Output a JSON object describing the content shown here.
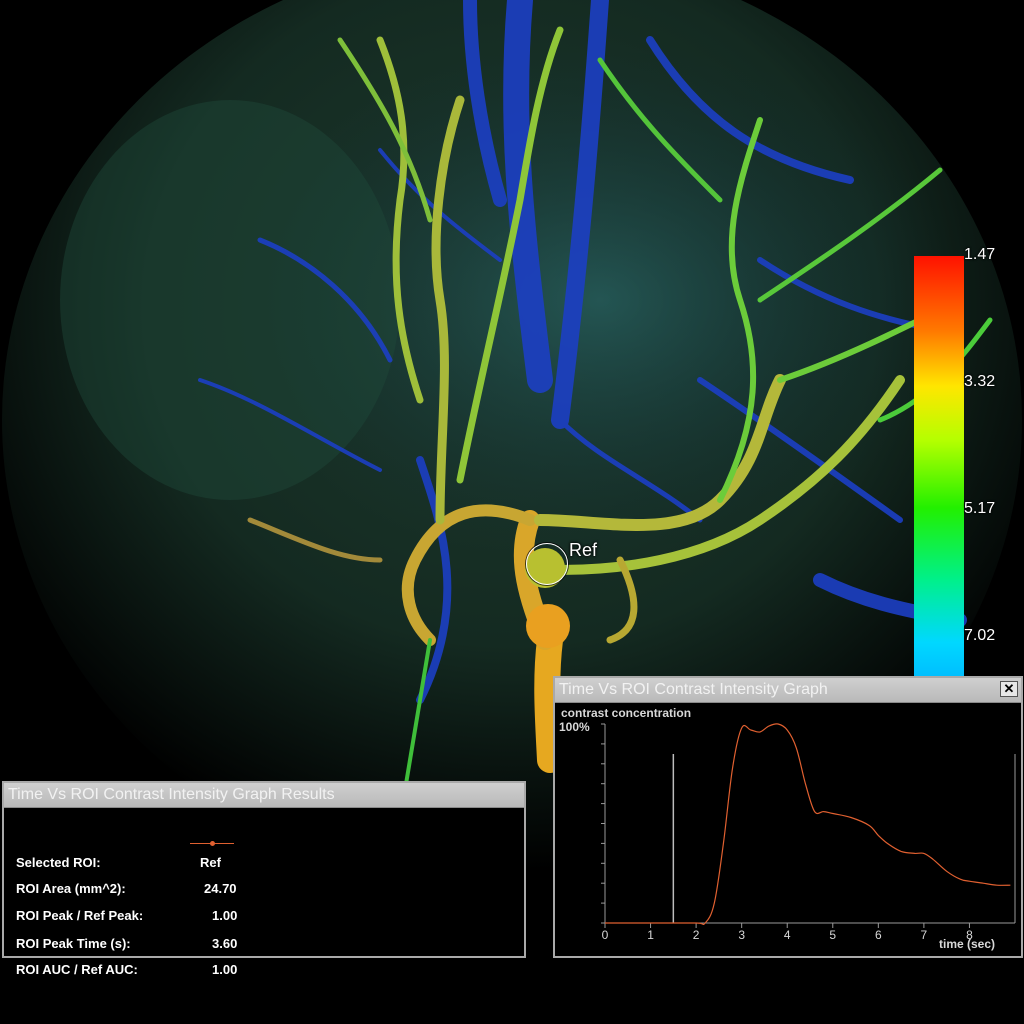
{
  "colorbar": {
    "labels": [
      "1.47",
      "3.32",
      "5.17",
      "7.02"
    ]
  },
  "roi": {
    "label": "Ref"
  },
  "results": {
    "title": "Time Vs ROI Contrast Intensity Graph Results",
    "rows": [
      {
        "label": "Selected ROI:",
        "value": "Ref"
      },
      {
        "label": "ROI Area (mm^2):",
        "value": "24.70"
      },
      {
        "label": "ROI Peak / Ref Peak:",
        "value": "1.00"
      },
      {
        "label": "ROI Peak Time (s):",
        "value": "3.60"
      },
      {
        "label": "ROI AUC / Ref AUC:",
        "value": "1.00"
      }
    ],
    "legend_color": "#e06030"
  },
  "graph": {
    "title": "Time Vs ROI Contrast Intensity Graph",
    "close_glyph": "✕",
    "y_caption": "contrast concentration",
    "y_top_label": "100%",
    "x_caption": "time (sec)",
    "marker_time": 1.5,
    "curve_color": "#e06030",
    "chart_data": {
      "type": "line",
      "xlabel": "time (sec)",
      "ylabel": "contrast concentration",
      "xlim": [
        0,
        9
      ],
      "ylim": [
        0,
        100
      ],
      "x_ticks": [
        "0",
        "1",
        "2",
        "3",
        "4",
        "5",
        "6",
        "7",
        "8"
      ],
      "series": [
        {
          "name": "Ref",
          "x": [
            0,
            1,
            2,
            2.2,
            2.4,
            2.6,
            2.8,
            3.0,
            3.2,
            3.4,
            3.6,
            3.8,
            4.0,
            4.2,
            4.4,
            4.6,
            4.8,
            5.0,
            5.4,
            5.8,
            6.0,
            6.2,
            6.5,
            6.8,
            7.0,
            7.2,
            7.5,
            7.8,
            8.0,
            8.3,
            8.6,
            8.9
          ],
          "y": [
            0,
            0,
            0,
            0,
            10,
            40,
            78,
            98,
            97,
            96,
            99,
            100,
            97,
            88,
            70,
            56,
            56,
            55,
            53,
            49,
            44,
            40,
            36,
            35,
            35,
            32,
            26,
            22,
            21,
            20,
            19,
            19
          ]
        }
      ]
    }
  }
}
